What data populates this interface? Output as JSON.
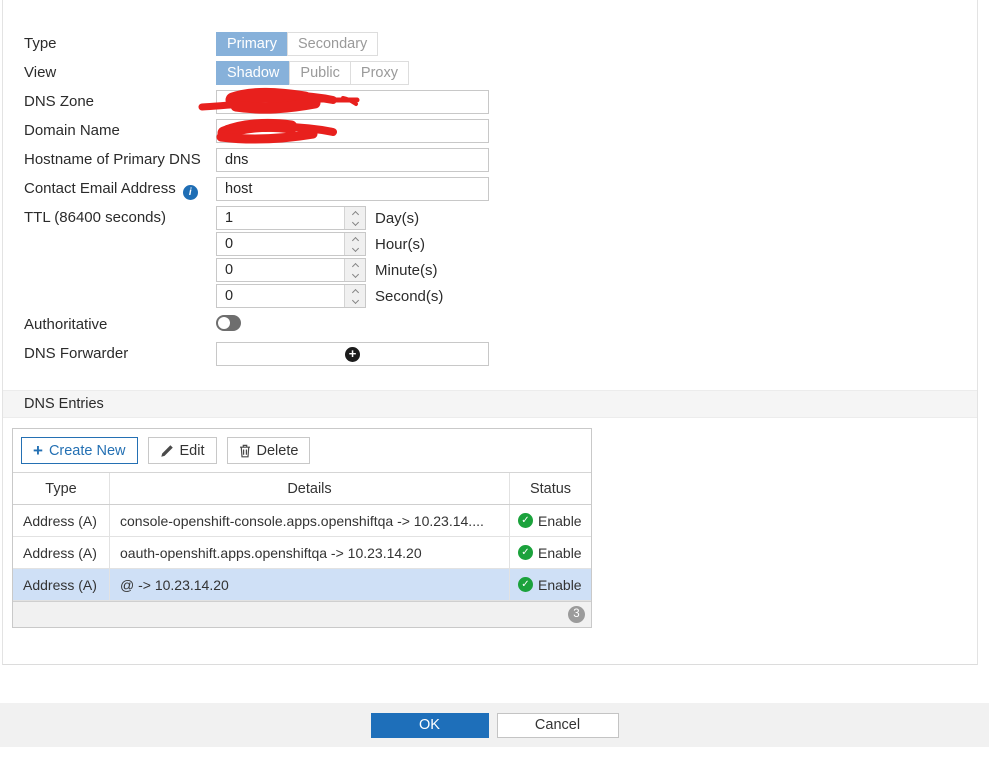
{
  "form": {
    "type": {
      "label": "Type",
      "options": [
        "Primary",
        "Secondary"
      ],
      "selected": "Primary"
    },
    "view": {
      "label": "View",
      "options": [
        "Shadow",
        "Public",
        "Proxy"
      ],
      "selected": "Shadow"
    },
    "dns_zone": {
      "label": "DNS Zone",
      "value": "",
      "redacted": true
    },
    "domain_name": {
      "label": "Domain Name",
      "value": "",
      "redacted": true
    },
    "hostname": {
      "label": "Hostname of Primary DNS",
      "value": "dns"
    },
    "contact_email": {
      "label": "Contact Email Address",
      "value": "host",
      "info_icon": "i"
    },
    "ttl": {
      "label": "TTL (86400 seconds)",
      "fields": [
        {
          "value": "1",
          "unit": "Day(s)"
        },
        {
          "value": "0",
          "unit": "Hour(s)"
        },
        {
          "value": "0",
          "unit": "Minute(s)"
        },
        {
          "value": "0",
          "unit": "Second(s)"
        }
      ]
    },
    "authoritative": {
      "label": "Authoritative",
      "state": "off"
    },
    "dns_forwarder": {
      "label": "DNS Forwarder",
      "add_icon": "+"
    }
  },
  "entries": {
    "section_title": "DNS Entries",
    "toolbar": {
      "create_label": "Create New",
      "create_plus": "+",
      "edit_label": "Edit",
      "delete_label": "Delete"
    },
    "table": {
      "headers": [
        "Type",
        "Details",
        "Status"
      ],
      "rows": [
        {
          "type": "Address (A)",
          "details": "console-openshift-console.apps.openshiftqa -> 10.23.14....",
          "status": "Enable",
          "selected": false
        },
        {
          "type": "Address (A)",
          "details": "oauth-openshift.apps.openshiftqa -> 10.23.14.20",
          "status": "Enable",
          "selected": false
        },
        {
          "type": "Address (A)",
          "details": "@ -> 10.23.14.20",
          "status": "Enable",
          "selected": true
        }
      ],
      "count_badge": "3"
    }
  },
  "footer": {
    "ok_label": "OK",
    "cancel_label": "Cancel"
  },
  "colors": {
    "accent_blue": "#2470b3",
    "segment_selected": "#87b1da",
    "ok_button": "#1e6fba",
    "enable_green": "#1ba23c",
    "selected_row": "#cfe0f6",
    "redaction_red": "#e8201d"
  }
}
